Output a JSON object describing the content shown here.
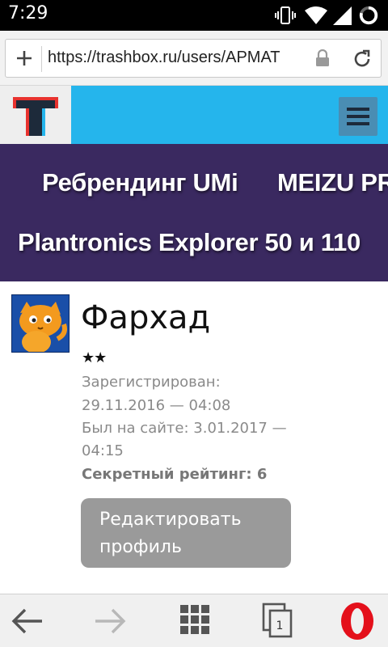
{
  "status_bar": {
    "time": "7:29",
    "icons": [
      "vibrate-icon",
      "wifi-icon",
      "signal-icon",
      "battery-icon"
    ]
  },
  "browser": {
    "url": "https://trashbox.ru/users/APMAT",
    "left_button_icon": "plus-icon",
    "lock_icon": "lock-icon",
    "reload_icon": "reload-icon"
  },
  "site": {
    "logo_letter": "T",
    "menu_icon": "hamburger-menu-icon",
    "colors": {
      "header_bg": "#25b5ec",
      "promo_bg": "#3a2960",
      "logo_red": "#e8322e",
      "logo_dark": "#1d2a3a"
    }
  },
  "promo": {
    "items": [
      "Ребрендинг UMi",
      "MEIZU PR",
      "Plantronics Explorer 50 и 110"
    ]
  },
  "profile": {
    "name": "Фархад",
    "stars": "★★",
    "registered_label": "Зарегистрирован:",
    "registered_value": "29.11.2016 — 04:08",
    "last_seen_label": "Был на сайте: 3.01.2017 —",
    "last_seen_value": "04:15",
    "rating_label": "Секретный рейтинг:",
    "rating_value": "6",
    "edit_button_label": "Редактировать профиль"
  },
  "bottom_nav": {
    "back_icon": "back-arrow-icon",
    "forward_icon": "forward-arrow-icon",
    "speed_dial_icon": "grid-icon",
    "tabs_icon": "tabs-icon",
    "tab_count": "1",
    "opera_icon": "opera-logo-icon"
  }
}
